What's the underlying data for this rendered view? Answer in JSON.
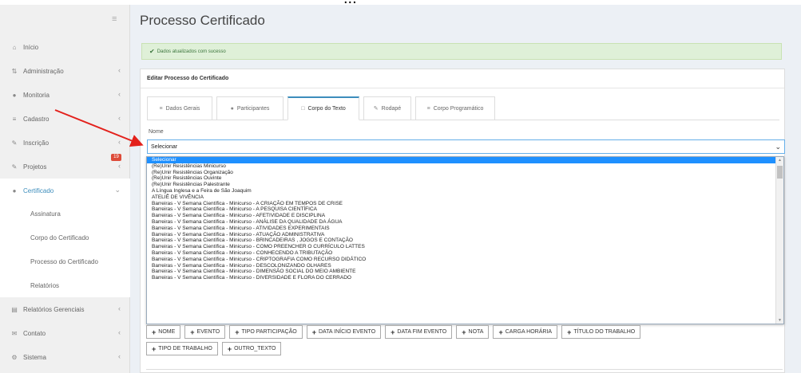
{
  "top_text": "...",
  "sidebar": {
    "menu_icon": "hamburger-icon",
    "items": [
      {
        "label": "Início",
        "icon": "home-icon"
      },
      {
        "label": "Administração",
        "icon": "arrows-icon"
      },
      {
        "label": "Monitoria",
        "icon": "users-icon"
      },
      {
        "label": "Cadastro",
        "icon": "list-icon"
      },
      {
        "label": "Inscrição",
        "icon": "edit-icon"
      },
      {
        "label": "Projetos",
        "icon": "edit-icon",
        "badge": "19"
      },
      {
        "label": "Certificado",
        "icon": "circle-icon"
      }
    ],
    "sub_items": [
      "Assinatura",
      "Corpo do Certificado",
      "Processo do Certificado",
      "Relatórios"
    ],
    "bottom_items": [
      {
        "label": "Relatórios Gerenciais",
        "icon": "report-icon"
      },
      {
        "label": "Contato",
        "icon": "mail-icon"
      },
      {
        "label": "Sistema",
        "icon": "cogs-icon"
      }
    ]
  },
  "page": {
    "title": "Processo Certificado",
    "alert": "Dados atualizados com sucesso",
    "panel_title": "Editar Processo do Certificado"
  },
  "tabs": [
    {
      "label": "Dados Gerais",
      "icon": "list-icon"
    },
    {
      "label": "Participantes",
      "icon": "users-icon"
    },
    {
      "label": "Corpo do Texto",
      "icon": "file-icon",
      "active": true
    },
    {
      "label": "Rodapé",
      "icon": "pencil-icon"
    },
    {
      "label": "Corpo Programático",
      "icon": "list-ol-icon"
    }
  ],
  "form": {
    "nome_label": "Nome",
    "nome_value": "Selecionar"
  },
  "dropdown_options": [
    "Selecionar",
    "(Re)Unir Resistências Minicurso",
    "(Re)Unir Resistências Organização",
    "(Re)Unir Resistências Ouvinte",
    "(Re)Unir Resistências Palestrante",
    "A Língua Inglesa e a Feira de São Joaquim",
    "ATELIÊ DE VIVÊNCIA",
    "Barreiras - V Semana Científica - Minicurso - A CRIAÇÃO EM TEMPOS DE CRISE",
    "Barreiras - V Semana Científica - Minicurso - A PESQUISA CIENTÍFICA",
    "Barreiras - V Semana Científica - Minicurso - AFETIVIDADE E DISCIPLINA",
    "Barreiras - V Semana Científica - Minicurso - ANÁLISE DA QUALIDADE DA ÁGUA",
    "Barreiras - V Semana Científica - Minicurso - ATIVIDADES EXPERIMENTAIS",
    "Barreiras - V Semana Científica - Minicurso - ATUAÇÃO ADMINISTRATIVA",
    "Barreiras - V Semana Científica - Minicurso - BRINCADEIRAS , JOGOS E CONTAÇÃO",
    "Barreiras - V Semana Científica - Minicurso - COMO PREENCHER O CURRÍCULO LATTES",
    "Barreiras - V Semana Científica - Minicurso - CONHECENDO A TRIBUTAÇÃO",
    "Barreiras - V Semana Científica - Minicurso - CRIPTOGRAFIA COMO RECURSO DIDÁTICO",
    "Barreiras - V Semana Científica - Minicurso - DESCOLONIZANDO OLHARES",
    "Barreiras - V Semana Científica - Minicurso - DIMENSÃO SOCIAL DO MEIO AMBIENTE",
    "Barreiras - V Semana Científica - Minicurso - DIVERSIDADE E FLORA DO CERRADO"
  ],
  "insert_buttons_row1": [
    "NOME",
    "EVENTO",
    "TIPO PARTICIPAÇÃO",
    "DATA INÍCIO EVENTO",
    "DATA FIM EVENTO",
    "NOTA",
    "CARGA HORÁRIA",
    "TÍTULO DO TRABALHO"
  ],
  "insert_buttons_row2": [
    "TIPO DE TRABALHO",
    "OUTRO_TEXTO"
  ],
  "colors": {
    "accent": "#3c8dbc",
    "alert_bg": "#dff0d8",
    "annotation_arrow": "#e3211c",
    "badge": "#dd4b39"
  }
}
